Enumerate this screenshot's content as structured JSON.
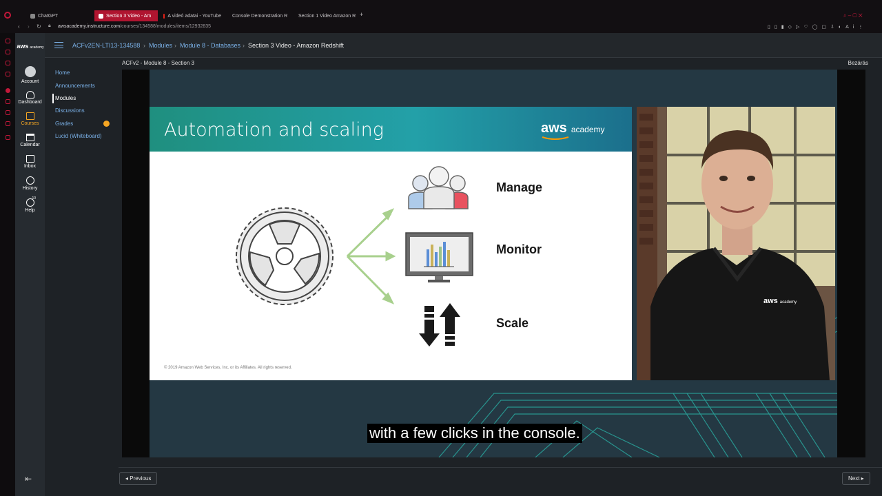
{
  "browser": {
    "tabs": [
      {
        "label": "ChatGPT",
        "active": false
      },
      {
        "label": "Section 3 Video - Am",
        "active": true
      },
      {
        "label": "A videó adatai - YouTube",
        "active": false
      },
      {
        "label": "Console Demonstration R",
        "active": false
      },
      {
        "label": "Section 1 Video Amazon R",
        "active": false
      }
    ],
    "url_host": "awsacademy.instructure.com",
    "url_path": "/courses/134588/modules/items/12932835"
  },
  "global_nav": {
    "logo": "aws academy",
    "items": [
      {
        "label": "Account",
        "icon": "account-icon"
      },
      {
        "label": "Dashboard",
        "icon": "dashboard-icon"
      },
      {
        "label": "Courses",
        "icon": "courses-icon"
      },
      {
        "label": "Calendar",
        "icon": "calendar-icon"
      },
      {
        "label": "Inbox",
        "icon": "inbox-icon"
      },
      {
        "label": "History",
        "icon": "history-icon"
      },
      {
        "label": "Help",
        "icon": "help-icon",
        "badge": "10"
      }
    ]
  },
  "breadcrumb": {
    "items": [
      "ACFv2EN-LTI13-134588",
      "Modules",
      "Module 8 - Databases",
      "Section 3 Video - Amazon Redshift"
    ]
  },
  "course_nav": {
    "items": [
      "Home",
      "Announcements",
      "Modules",
      "Discussions",
      "Grades",
      "Lucid (Whiteboard)"
    ],
    "grades_badge_color": "#f5a623"
  },
  "toolbar": {
    "module_title": "ACFv2 - Module 8 - Section 3",
    "close_label": "Bezárás"
  },
  "slide": {
    "title": "Automation and scaling",
    "brand": "aws",
    "brand_sub": "academy",
    "labels": {
      "manage": "Manage",
      "monitor": "Monitor",
      "scale": "Scale"
    },
    "copyright": "© 2019 Amazon Web Services, Inc. or its Affiliates. All rights reserved."
  },
  "presenter": {
    "shirt_logo": "aws",
    "shirt_logo_sub": "academy"
  },
  "caption": "with a few clicks in the console.",
  "footer": {
    "previous": "◂ Previous",
    "next": "Next ▸"
  },
  "colors": {
    "accent": "#b01530",
    "teal": "#23a0a8",
    "link": "#7ab0e6"
  }
}
